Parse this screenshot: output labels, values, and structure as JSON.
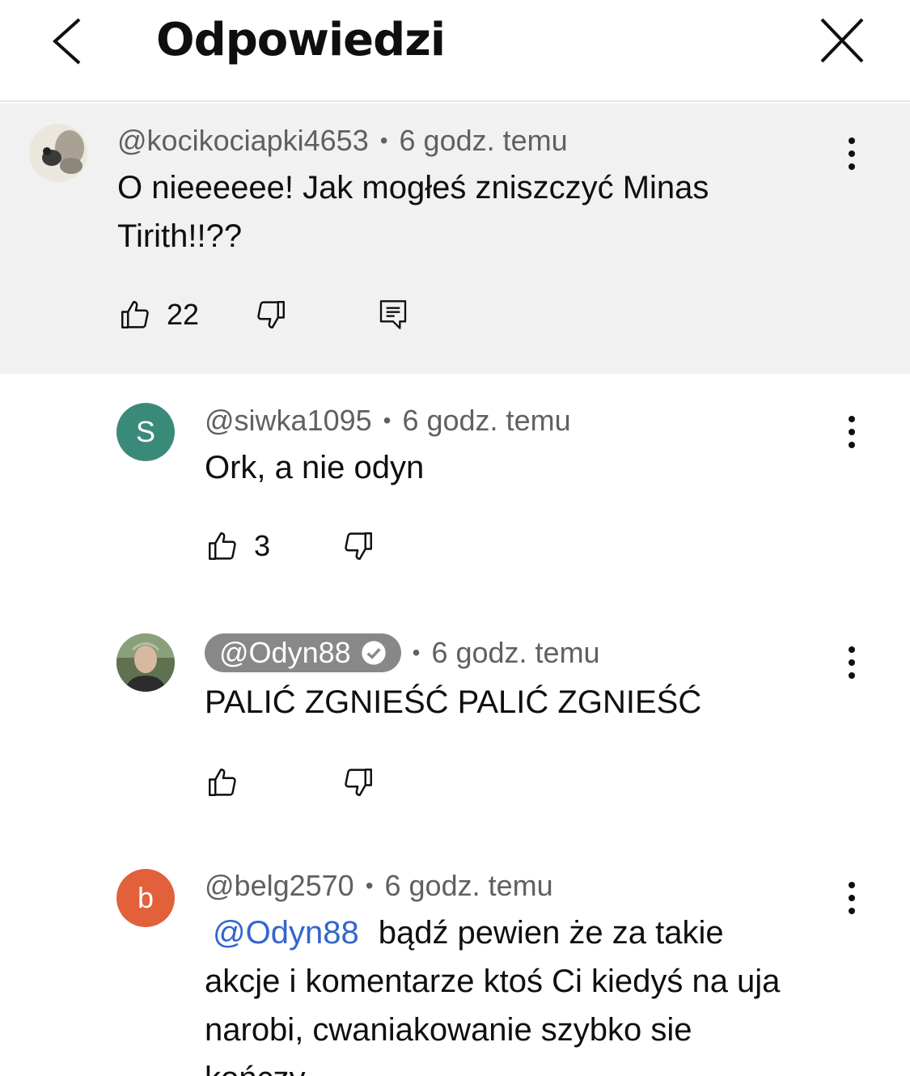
{
  "header": {
    "title": "Odpowiedzi"
  },
  "parent_comment": {
    "handle": "@kocikociapki4653",
    "time": "6 godz. temu",
    "text": "O nieeeeee! Jak mogłeś zniszczyć Minas Tirith!!??",
    "likes": "22"
  },
  "replies": [
    {
      "handle": "@siwka1095",
      "avatar_letter": "S",
      "avatar_color": "#3a8a7a",
      "time": "6 godz. temu",
      "text": "Ork, a nie odyn",
      "likes": "3"
    },
    {
      "handle": "@Odyn88",
      "time": "6 godz. temu",
      "text": "PALIĆ ZGNIEŚĆ PALIĆ ZGNIEŚĆ",
      "likes": ""
    },
    {
      "handle": "@belg2570",
      "avatar_letter": "b",
      "avatar_color": "#e2603a",
      "time": "6 godz. temu",
      "mention": "@Odyn88",
      "line1": "bądź pewien że za takie",
      "line2": "akcje i komentarze ktoś Ci kiedyś na uja",
      "line3": "narobi, cwaniakowanie szybko sie",
      "line4": "kończy"
    }
  ],
  "icons": {
    "back": "chevron-left-icon",
    "close": "close-icon",
    "like": "thumb-up-icon",
    "dislike": "thumb-down-icon",
    "reply": "reply-icon",
    "more": "more-vert-icon",
    "verified": "verified-check-icon"
  },
  "colors": {
    "parent_bg": "#f1f1f1",
    "mention": "#3366cc",
    "chip": "#888888"
  }
}
